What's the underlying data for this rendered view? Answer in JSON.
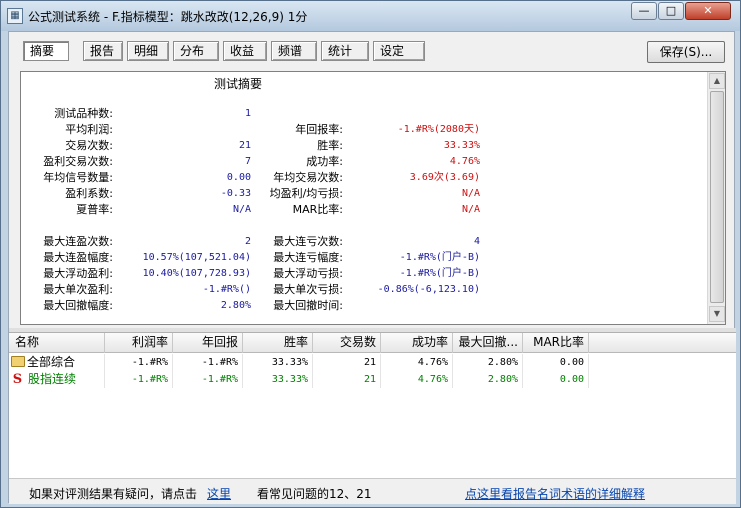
{
  "window": {
    "title": "公式测试系统 - F.指标模型：跳水改改(12,26,9) 1分",
    "app_icon_glyph": "▦",
    "min_label": "—",
    "max_label": "□",
    "close_label": "✕"
  },
  "tabs": [
    {
      "label": "摘要",
      "active": true
    },
    {
      "label": "报告",
      "active": false
    },
    {
      "label": "明细",
      "active": false
    },
    {
      "label": "分布",
      "active": false
    },
    {
      "label": "收益",
      "active": false
    },
    {
      "label": "频谱",
      "active": false
    },
    {
      "label": "统计",
      "active": false
    },
    {
      "label": "设定",
      "active": false
    }
  ],
  "save_label": "保存(S)...",
  "summary": {
    "title": "测试摘要",
    "left": [
      {
        "label": "测试品种数:",
        "value": "1"
      },
      {
        "label": "平均利润:",
        "value": ""
      },
      {
        "label": "交易次数:",
        "value": "21"
      },
      {
        "label": "盈利交易次数:",
        "value": "7"
      },
      {
        "label": "年均信号数量:",
        "value": "0.00"
      },
      {
        "label": "盈利系数:",
        "value": "-0.33"
      },
      {
        "label": "夏普率:",
        "value": "N/A"
      },
      {
        "label": "",
        "value": ""
      },
      {
        "label": "最大连盈次数:",
        "value": "2"
      },
      {
        "label": "最大连盈幅度:",
        "value": "10.57%(107,521.04)"
      },
      {
        "label": "最大浮动盈利:",
        "value": "10.40%(107,728.93)"
      },
      {
        "label": "最大单次盈利:",
        "value": "-1.#R%()"
      },
      {
        "label": "最大回撤幅度:",
        "value": "2.80%"
      }
    ],
    "right": [
      {
        "label": "",
        "value": ""
      },
      {
        "label": "年回报率:",
        "value": "-1.#R%(2080天)"
      },
      {
        "label": "胜率:",
        "value": "33.33%"
      },
      {
        "label": "成功率:",
        "value": "4.76%"
      },
      {
        "label": "年均交易次数:",
        "value": "3.69次(3.69)"
      },
      {
        "label": "均盈利/均亏损:",
        "value": "N/A"
      },
      {
        "label": "MAR比率:",
        "value": "N/A"
      },
      {
        "label": "",
        "value": ""
      },
      {
        "label": "最大连亏次数:",
        "value": "4"
      },
      {
        "label": "最大连亏幅度:",
        "value": "-1.#R%(门户-B)"
      },
      {
        "label": "最大浮动亏损:",
        "value": "-1.#R%(门户-B)"
      },
      {
        "label": "最大单次亏损:",
        "value": "-0.86%(-6,123.10)"
      },
      {
        "label": "最大回撤时间:",
        "value": ""
      }
    ]
  },
  "grid": {
    "headers": [
      "名称",
      "利润率",
      "年回报",
      "胜率",
      "交易数",
      "成功率",
      "最大回撤...",
      "MAR比率"
    ],
    "rows": [
      {
        "icon": "folder-icon",
        "name": "全部综合",
        "color": "#000000",
        "cells": [
          "-1.#R%",
          "-1.#R%",
          "33.33%",
          "21",
          "4.76%",
          "2.80%",
          "0.00"
        ]
      },
      {
        "icon": "s-icon",
        "name": "股指连续",
        "color": "#008000",
        "cells": [
          "-1.#R%",
          "-1.#R%",
          "33.33%",
          "21",
          "4.76%",
          "2.80%",
          "0.00"
        ]
      }
    ]
  },
  "status": {
    "prefix": "如果对评测结果有疑问，请点击",
    "link1": "这里",
    "middle": "看常见问题的12、21",
    "link2": "点这里看报告名词术语的详细解释"
  },
  "colors": {
    "value_blue": "#1a1aa0",
    "value_red": "#cc1010",
    "row_green": "#008000",
    "link": "#0645ad"
  }
}
